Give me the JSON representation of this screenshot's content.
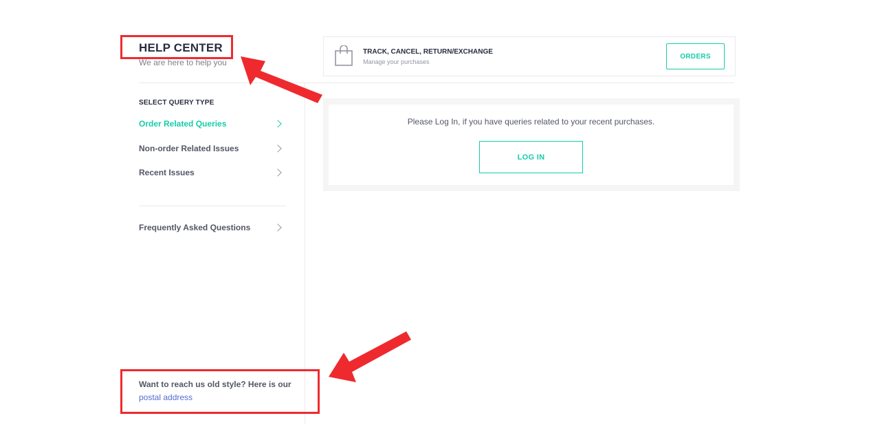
{
  "header": {
    "title": "HELP CENTER",
    "subtitle": "We are here to help you"
  },
  "sidebar": {
    "section_label": "SELECT QUERY TYPE",
    "items": [
      {
        "label": "Order Related Queries",
        "active": true
      },
      {
        "label": "Non-order Related Issues",
        "active": false
      },
      {
        "label": "Recent Issues",
        "active": false
      }
    ],
    "faq_label": "Frequently Asked Questions",
    "postal": {
      "text": "Want to reach us old style? Here is our",
      "link": "postal address"
    }
  },
  "track": {
    "icon": "shopping-bag-icon",
    "title": "TRACK, CANCEL, RETURN/EXCHANGE",
    "subtitle": "Manage your purchases",
    "button_label": "ORDERS"
  },
  "login": {
    "message": "Please Log In, if you have queries related to your recent purchases.",
    "button_label": "LOG IN"
  },
  "colors": {
    "accent": "#14cda8",
    "annotation": "#ee2a2e",
    "link": "#526cd0"
  }
}
